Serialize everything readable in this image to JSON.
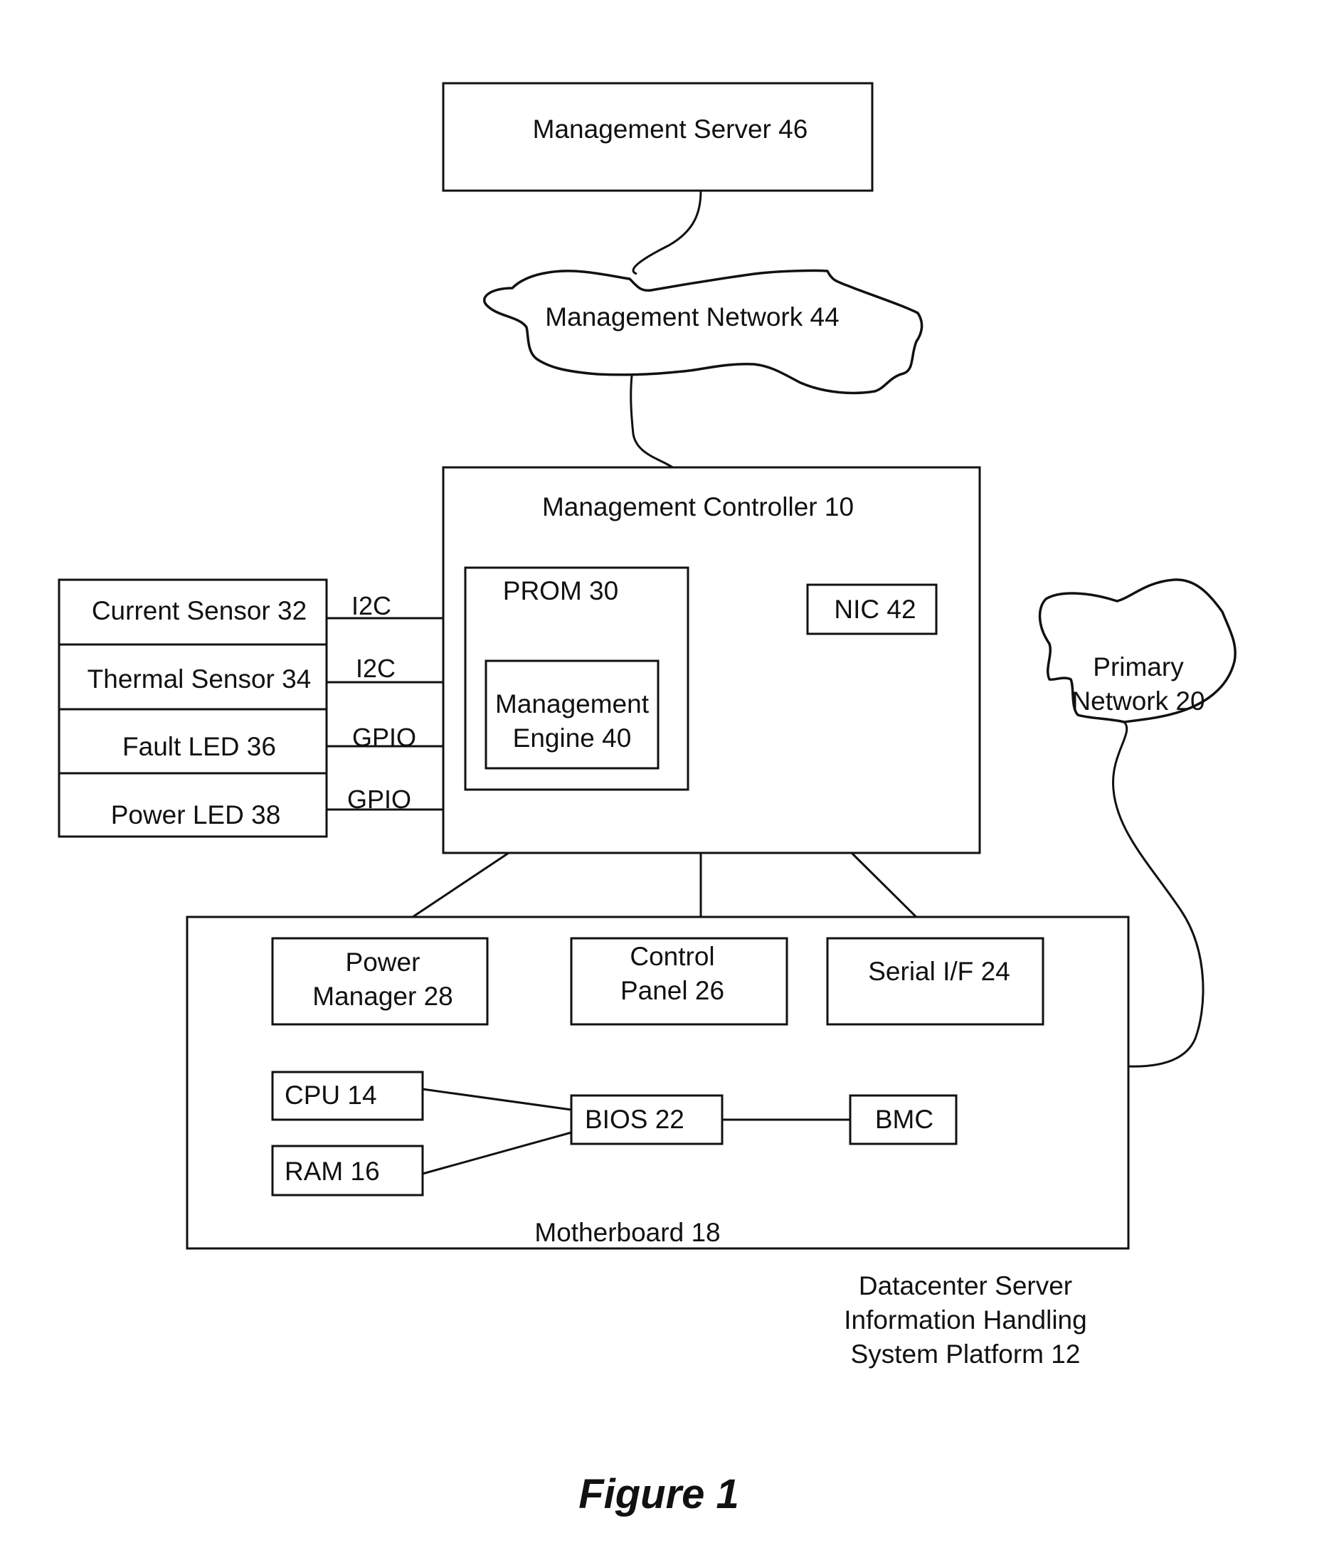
{
  "diagram": {
    "management_server": "Management Server 46",
    "management_network": "Management Network 44",
    "management_controller": "Management Controller 10",
    "prom": "PROM 30",
    "management_engine": [
      "Management",
      "Engine 40"
    ],
    "nic": "NIC 42",
    "primary_network": [
      "Primary",
      "Network 20"
    ],
    "sensors": [
      {
        "label": "Current Sensor 32",
        "bus": "I2C"
      },
      {
        "label": "Thermal Sensor 34",
        "bus": "I2C"
      },
      {
        "label": "Fault LED  36",
        "bus": "GPIO"
      },
      {
        "label": "Power LED  38",
        "bus": "GPIO"
      }
    ],
    "motherboard": "Motherboard 18",
    "power_manager": [
      "Power",
      "Manager 28"
    ],
    "control_panel": [
      "Control",
      "Panel 26"
    ],
    "serial_if": "Serial I/F 24",
    "cpu": "CPU 14",
    "ram": "RAM 16",
    "bios": "BIOS 22",
    "bmc": "BMC",
    "platform": [
      "Datacenter Server",
      "Information Handling",
      "System Platform  12"
    ],
    "figure_caption": "Figure 1"
  }
}
